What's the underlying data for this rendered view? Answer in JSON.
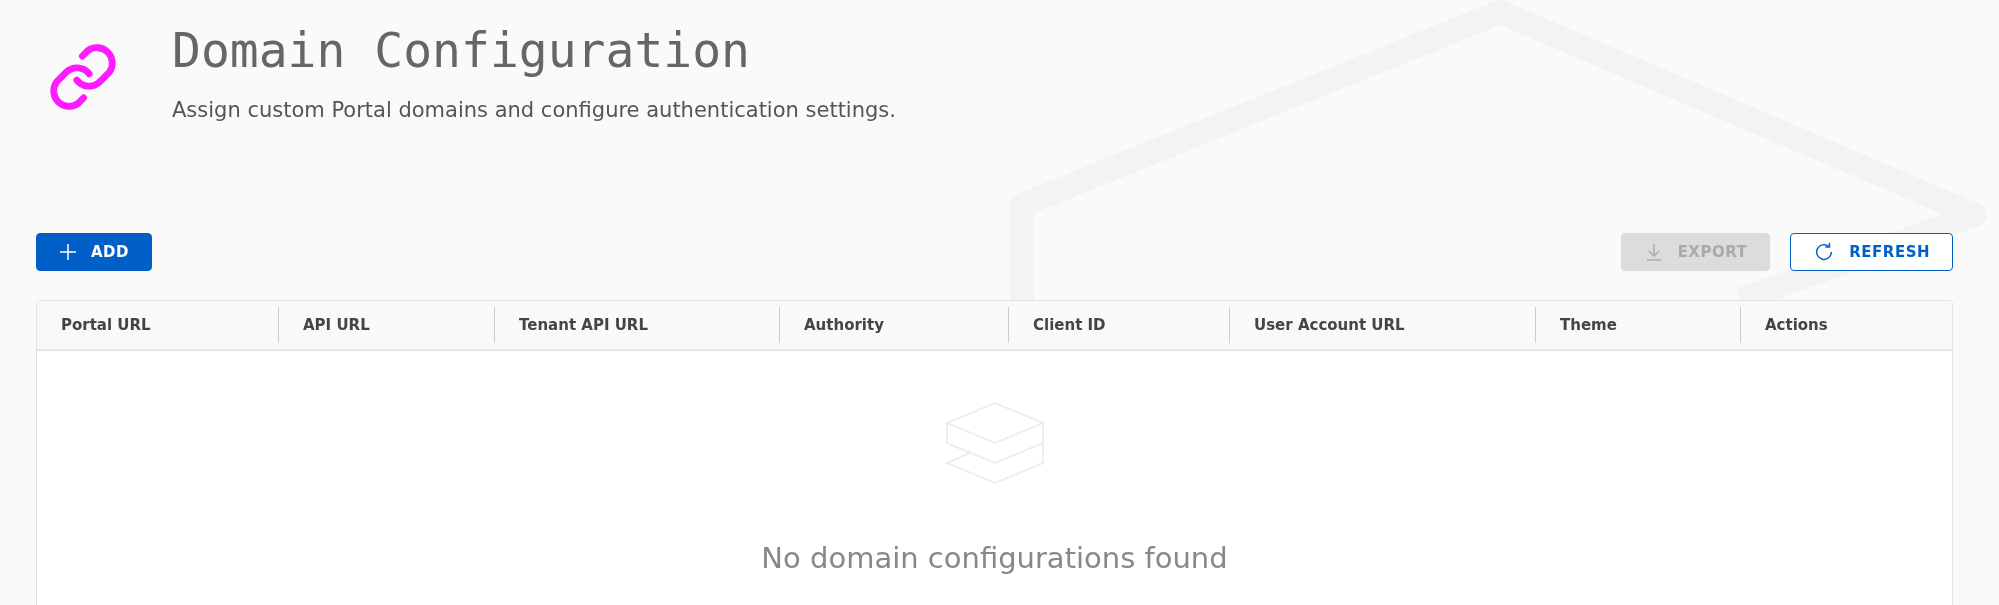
{
  "header": {
    "title": "Domain Configuration",
    "subtitle": "Assign custom Portal domains and configure authentication settings."
  },
  "toolbar": {
    "add": {
      "label": "ADD",
      "disabled": false
    },
    "export": {
      "label": "EXPORT",
      "disabled": true
    },
    "refresh": {
      "label": "REFRESH",
      "disabled": false
    }
  },
  "table": {
    "columns": [
      "Portal URL",
      "API URL",
      "Tenant API URL",
      "Authority",
      "Client ID",
      "User Account URL",
      "Theme",
      "Actions"
    ],
    "empty_message": "No domain configurations found"
  }
}
